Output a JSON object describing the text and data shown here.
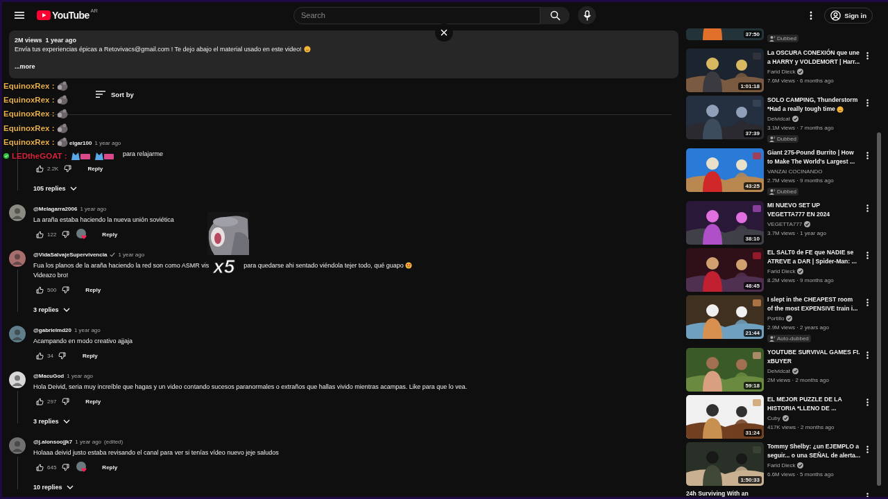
{
  "topbar": {
    "logo": "YouTube",
    "region": "AR",
    "search": {
      "placeholder": "Search"
    },
    "sign_in": "Sign in"
  },
  "description": {
    "views": "2M views",
    "age": "1 year ago",
    "text": "Envía tus experiencias épicas a Retovivacs@gmail.com ! Te dejo abajo el material usado en este video!",
    "emoji": true,
    "more": "...more"
  },
  "comments_header": {
    "sort": "Sort by"
  },
  "comments": [
    {
      "kind": "partial",
      "author": "elgar100",
      "verified": false,
      "time": "1 year ago",
      "lines": [
        {
          "segments": [
            "para relajarme"
          ],
          "emoji": false
        }
      ],
      "likes": "2.2K",
      "hearted": false,
      "reply": "Reply",
      "replies": "105 replies"
    },
    {
      "kind": "full",
      "author": "@Melagarra2006",
      "verified": false,
      "time": "1 year ago",
      "lines": [
        {
          "segments": [
            "La araña estaba haciendo la nueva unión soviética"
          ],
          "emoji": false
        }
      ],
      "likes": "122",
      "hearted": true,
      "reply": "Reply"
    },
    {
      "kind": "full",
      "author": "@VidaSalvajeSupervivencia",
      "verified": true,
      "time": "1 year ago",
      "lines": [
        {
          "segments": [
            "Fua los planos de la araña haciendo la red son como ASMR vis",
            "para quedarse ahi sentado viéndola tejer todo, qué guapo"
          ],
          "emoji": true
        },
        {
          "segments": [
            "Videazo bro!"
          ],
          "emoji": false
        }
      ],
      "likes": "500",
      "hearted": false,
      "reply": "Reply",
      "replies": "3 replies"
    },
    {
      "kind": "full",
      "author": "@gabrielmd20",
      "verified": false,
      "time": "1 year ago",
      "lines": [
        {
          "segments": [
            "Acampando en modo creativo ajjaja"
          ],
          "emoji": false
        }
      ],
      "likes": "34",
      "hearted": false,
      "reply": "Reply"
    },
    {
      "kind": "full",
      "author": "@MacuGod",
      "verified": false,
      "time": "1 year ago",
      "lines": [
        {
          "segments": [
            "Hola Deivid, seria muy increíble que hagas y un video contando sucesos paranormales o extraños que hallas vivido mientras acampas. Like para que lo vea."
          ],
          "emoji": false
        }
      ],
      "likes": "297",
      "hearted": false,
      "reply": "Reply",
      "replies": "3 replies"
    },
    {
      "kind": "full",
      "author": "@j.alonsoojjk7",
      "verified": false,
      "time": "1 year ago",
      "edited": "(edited)",
      "lines": [
        {
          "segments": [
            "Holaaa deivid justo estaba revisando el canal para ver si tenías vídeo nuevo jeje saludos"
          ],
          "emoji": false
        }
      ],
      "likes": "645",
      "hearted": true,
      "reply": "Reply",
      "replies": "10 replies"
    }
  ],
  "sticker": {
    "label": "x5"
  },
  "chat_overlay": [
    {
      "user": "EquinoxRex :",
      "color": "#e8b04a",
      "badge": false,
      "emotes": [
        {
          "kind": "rat"
        }
      ]
    },
    {
      "user": "EquinoxRex :",
      "color": "#e8b04a",
      "badge": false,
      "emotes": [
        {
          "kind": "rat"
        }
      ]
    },
    {
      "user": "EquinoxRex :",
      "color": "#e8b04a",
      "badge": false,
      "emotes": [
        {
          "kind": "rat"
        }
      ]
    },
    {
      "user": "EquinoxRex :",
      "color": "#e8b04a",
      "badge": false,
      "emotes": [
        {
          "kind": "rat"
        }
      ]
    },
    {
      "user": "EquinoxRex :",
      "color": "#e8b04a",
      "badge": false,
      "emotes": [
        {
          "kind": "rat"
        }
      ]
    },
    {
      "user": "LEDtheGOAT :",
      "color": "#d8243c",
      "badge": true,
      "emotes": [
        {
          "kind": "vibes"
        },
        {
          "kind": "vibes"
        }
      ]
    }
  ],
  "related": [
    {
      "kind": "partial_top",
      "duration": "37:50",
      "badge": "Dubbed"
    },
    {
      "kind": "video",
      "title_lines": [
        "La OSCURA CONEXIÓN que une",
        "a HARRY y VOLDEMORT | Harr..."
      ],
      "emoji": false,
      "channel": "Farid Dieck",
      "verified": true,
      "meta": "7.6M views · 6 months ago",
      "duration": "1:01:18"
    },
    {
      "kind": "video",
      "title_lines": [
        "SOLO CAMPING, Thunderstorm",
        "*Had a really tough time"
      ],
      "emoji": true,
      "channel": "Deividcat",
      "verified": true,
      "meta": "3.1M views · 7 months ago",
      "duration": "37:39",
      "badge": "Dubbed"
    },
    {
      "kind": "video",
      "title_lines": [
        "Giant 275-Pound Burrito | How",
        "to Make The World's Largest ..."
      ],
      "emoji": false,
      "channel": "VANZAI COCINANDO",
      "verified": false,
      "meta": "2.7M views · 9 months ago",
      "duration": "43:25",
      "badge": "Dubbed"
    },
    {
      "kind": "video",
      "title_lines": [
        "MI NUEVO SET UP",
        "VEGETTA777 EN 2024"
      ],
      "emoji": false,
      "channel": "VEGETTA777",
      "verified": true,
      "meta": "3.7M views · 1 year ago",
      "duration": "38:10"
    },
    {
      "kind": "video",
      "title_lines": [
        "EL SALT0 de FE que NADIE se",
        "ATREVE a DAR | Spider-Man: ..."
      ],
      "emoji": false,
      "channel": "Farid Dieck",
      "verified": true,
      "meta": "8.2M views · 9 months ago",
      "duration": "48:45"
    },
    {
      "kind": "video",
      "title_lines": [
        "I slept in the CHEAPEST room",
        "of the most EXPENSIVE train i..."
      ],
      "emoji": false,
      "channel": "Portillo",
      "verified": true,
      "meta": "2.9M views · 2 years ago",
      "duration": "21:44",
      "badge": "Auto-dubbed"
    },
    {
      "kind": "video",
      "title_lines": [
        "YOUTUBE SURVIVAL GAMES Ft.",
        "xBUYER"
      ],
      "emoji": false,
      "channel": "Deividcat",
      "verified": true,
      "meta": "2M views · 2 months ago",
      "duration": "59:18"
    },
    {
      "kind": "video",
      "title_lines": [
        "EL MEJOR PUZZLE DE LA",
        "HISTORIA *LLENO DE ..."
      ],
      "emoji": false,
      "channel": "Cuby",
      "verified": true,
      "meta": "417K views · 2 months ago",
      "duration": "31:24"
    },
    {
      "kind": "video",
      "title_lines": [
        "Tommy Shelby: ¿un EJEMPLO a",
        "seguir... o una SEÑAL de alerta..."
      ],
      "emoji": false,
      "channel": "Farid Dieck",
      "verified": true,
      "meta": "6.6M views · 5 months ago",
      "duration": "1:50:33"
    },
    {
      "kind": "partial_bottom",
      "title_lines": [
        "24h Surviving With an"
      ]
    }
  ]
}
